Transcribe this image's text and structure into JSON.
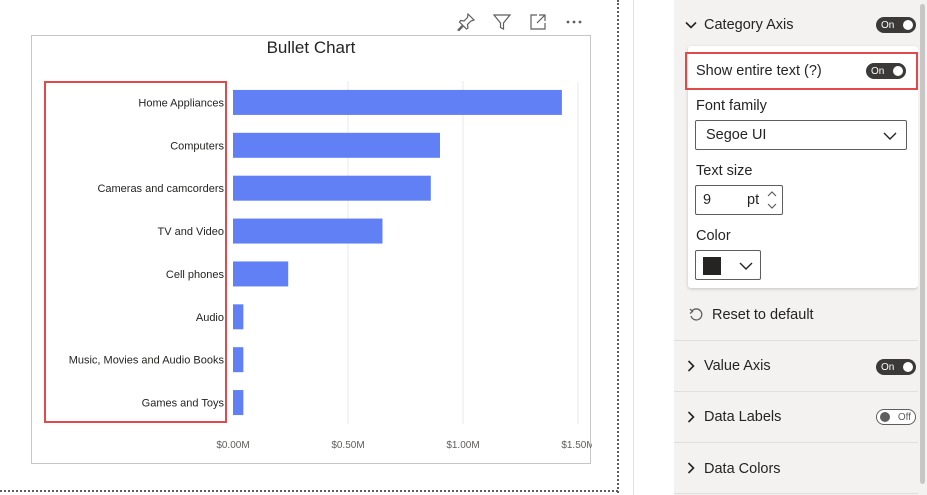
{
  "toolbar": {
    "icons": [
      "pin-icon",
      "filter-icon",
      "focus-mode-icon",
      "more-options-icon"
    ]
  },
  "chart_data": {
    "type": "bar",
    "orientation": "horizontal",
    "title": "Bullet Chart",
    "categories": [
      "Home Appliances",
      "Computers",
      "Cameras and camcorders",
      "TV and Video",
      "Cell phones",
      "Audio",
      "Music, Movies and Audio Books",
      "Games and Toys"
    ],
    "values": [
      1430000,
      900000,
      860000,
      650000,
      240000,
      45000,
      45000,
      45000
    ],
    "xlim": [
      0,
      1500000
    ],
    "x_ticks": [
      0,
      500000,
      1000000,
      1500000
    ],
    "x_tick_labels": [
      "$0.00M",
      "$0.50M",
      "$1.00M",
      "$1.50M"
    ],
    "grid": true,
    "bar_color": "#6180f6"
  },
  "pane": {
    "category_axis": {
      "label": "Category Axis",
      "toggle": "On",
      "show_entire_text": {
        "label": "Show entire text (?)",
        "toggle": "On"
      },
      "font_family": {
        "label": "Font family",
        "value": "Segoe UI"
      },
      "text_size": {
        "label": "Text size",
        "value": "9",
        "unit": "pt"
      },
      "color": {
        "label": "Color",
        "value": "#252423"
      }
    },
    "reset_label": "Reset to default",
    "value_axis": {
      "label": "Value Axis",
      "toggle": "On"
    },
    "data_labels": {
      "label": "Data Labels",
      "toggle": "Off"
    },
    "data_colors": {
      "label": "Data Colors"
    }
  },
  "colors": {
    "accent_highlight": "#e04a4a",
    "toggle_on": "#3b3a39"
  }
}
